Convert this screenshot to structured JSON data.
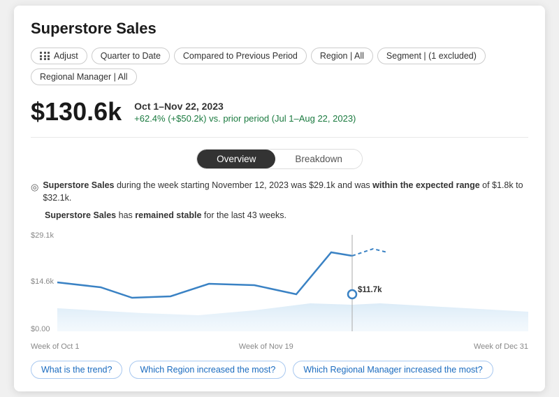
{
  "title": "Superstore Sales",
  "filters": [
    {
      "label": "Adjust",
      "id": "adjust",
      "isAdjust": true
    },
    {
      "label": "Quarter to Date",
      "id": "quarter"
    },
    {
      "label": "Compared to Previous Period",
      "id": "compare"
    },
    {
      "label": "Region | All",
      "id": "region"
    },
    {
      "label": "Segment | (1 excluded)",
      "id": "segment"
    },
    {
      "label": "Regional Manager | All",
      "id": "manager"
    }
  ],
  "metric": {
    "value": "$130.6k",
    "period": "Oct 1–Nov 22, 2023",
    "change": "+62.4% (+$50.2k) vs. prior period (Jul 1–Aug 22, 2023)"
  },
  "tabs": [
    "Overview",
    "Breakdown"
  ],
  "activeTab": "Overview",
  "insight1_prefix": "Superstore Sales",
  "insight1_middle": " during the week starting November 12, 2023 was $29.1k and was ",
  "insight1_bold": "within the expected range",
  "insight1_suffix": " of $1.8k to $32.1k.",
  "insight2_prefix": "Superstore Sales",
  "insight2_middle": " has ",
  "insight2_bold": "remained stable",
  "insight2_suffix": " for the last 43 weeks.",
  "chart": {
    "yLabels": [
      "$29.1k",
      "$14.6k",
      "$0.00"
    ],
    "xLabels": [
      "Week of Oct 1",
      "Week of Nov 19",
      "Week of Dec 31"
    ],
    "dataPointLabel": "$11.7k"
  },
  "bottomLinks": [
    "What is the trend?",
    "Which Region increased the most?",
    "Which Regional Manager increased the most?"
  ]
}
